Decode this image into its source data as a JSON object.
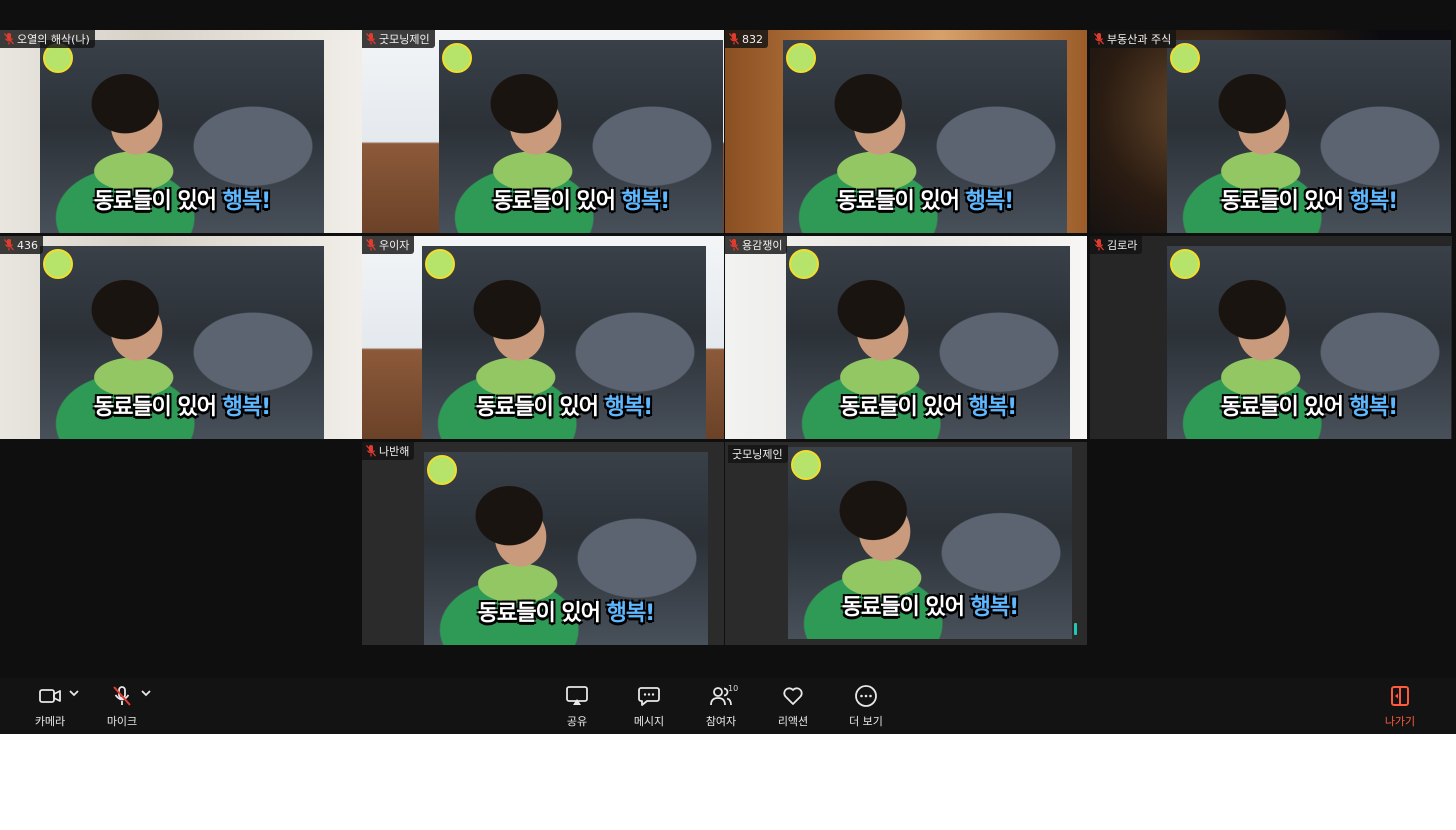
{
  "meeting": {
    "caption_part1": "동료들이 있어 ",
    "caption_part2": "행복!",
    "tiles": [
      {
        "name": "오열의 해삭(나)",
        "muted": true
      },
      {
        "name": "굿모닝제인",
        "muted": true
      },
      {
        "name": "832",
        "muted": true
      },
      {
        "name": "부동산과 주식",
        "muted": true
      },
      {
        "name": "436",
        "muted": true
      },
      {
        "name": "우이자",
        "muted": true
      },
      {
        "name": "용감쟁이",
        "muted": true
      },
      {
        "name": "김로라",
        "muted": true
      },
      {
        "name": "나반해",
        "muted": true
      },
      {
        "name": "굿모닝제인",
        "muted": false,
        "active_speaker": true
      }
    ]
  },
  "toolbar": {
    "camera_label": "카메라",
    "mic_label": "마이크",
    "share_label": "공유",
    "message_label": "메시지",
    "participants_label": "참여자",
    "participants_count": "10",
    "reaction_label": "리액션",
    "more_label": "더 보기",
    "leave_label": "나가기",
    "leave_color": "#ff5a3c",
    "active_border_color": "#20c8b8"
  }
}
